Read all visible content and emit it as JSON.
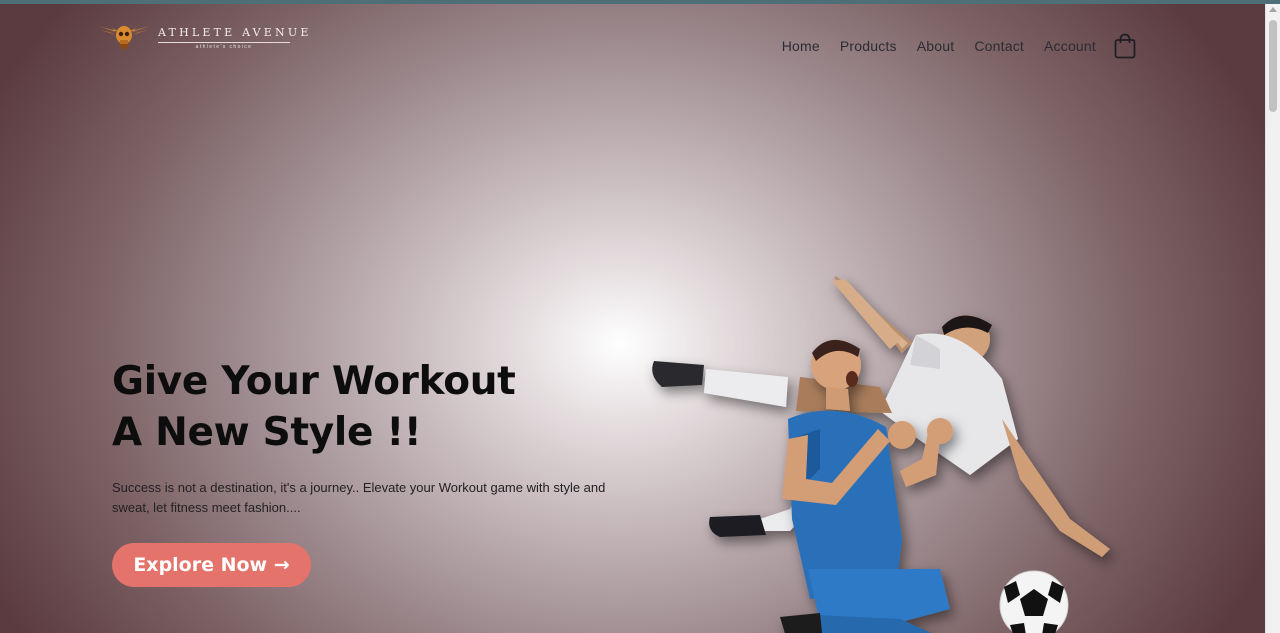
{
  "brand": {
    "name": "ATHLETE AVENUE",
    "tagline": "athlete's choice"
  },
  "nav": {
    "items": [
      "Home",
      "Products",
      "About",
      "Contact",
      "Account"
    ],
    "cart_icon": "shopping-bag-icon"
  },
  "hero": {
    "headline_line1": "Give Your Workout",
    "headline_line2": "A New Style !!",
    "description": "Success is not a destination, it's a journey.. Elevate your Workout game with style and sweat, let fitness meet fashion....",
    "cta_label": "Explore Now →",
    "image": "two-soccer-players-celebrating"
  },
  "colors": {
    "accent": "#e3736b",
    "text_dark": "#0d0d0d",
    "bg_dark": "#5b3b40",
    "bg_light": "#ffffff"
  }
}
